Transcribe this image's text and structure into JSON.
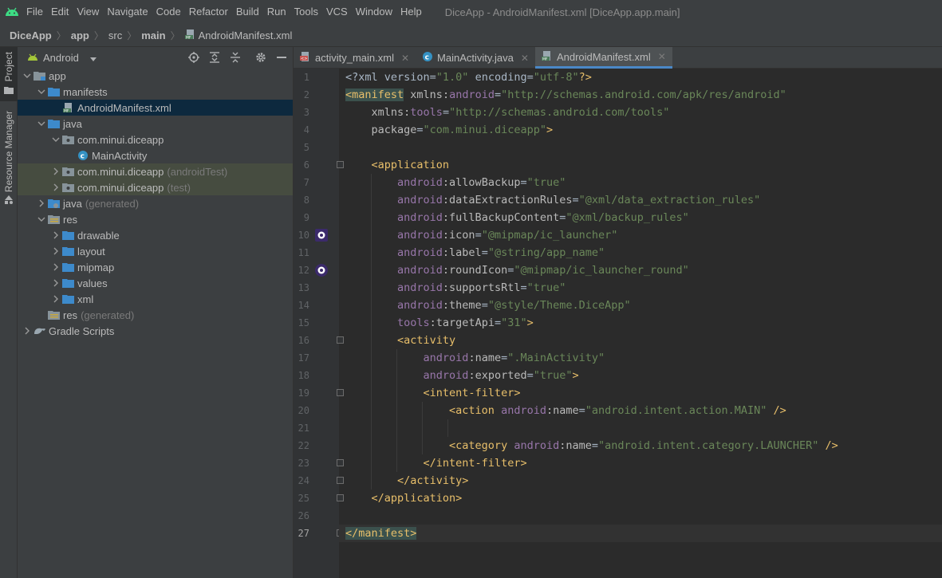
{
  "menubar": {
    "items": [
      "File",
      "Edit",
      "View",
      "Navigate",
      "Code",
      "Refactor",
      "Build",
      "Run",
      "Tools",
      "VCS",
      "Window",
      "Help"
    ],
    "title": "DiceApp - AndroidManifest.xml [DiceApp.app.main]"
  },
  "breadcrumb": [
    "DiceApp",
    "app",
    "src",
    "main",
    "AndroidManifest.xml"
  ],
  "toolstrip": {
    "project": "Project",
    "resource_manager": "Resource Manager"
  },
  "project_panel": {
    "view": "Android",
    "tree": [
      {
        "label": "app",
        "depth": 0,
        "arrow": "down",
        "icon": "module-folder-icon"
      },
      {
        "label": "manifests",
        "depth": 1,
        "arrow": "down",
        "icon": "folder-icon"
      },
      {
        "label": "AndroidManifest.xml",
        "depth": 2,
        "arrow": "",
        "icon": "manifest-file-icon",
        "selected": true
      },
      {
        "label": "java",
        "depth": 1,
        "arrow": "down",
        "icon": "folder-icon"
      },
      {
        "label": "com.minui.diceapp",
        "depth": 2,
        "arrow": "down",
        "icon": "package-icon"
      },
      {
        "label": "MainActivity",
        "depth": 3,
        "arrow": "",
        "icon": "class-icon"
      },
      {
        "label": "com.minui.diceapp",
        "suffix": "(androidTest)",
        "depth": 2,
        "arrow": "right",
        "icon": "package-icon",
        "tested": true
      },
      {
        "label": "com.minui.diceapp",
        "suffix": "(test)",
        "depth": 2,
        "arrow": "right",
        "icon": "package-icon",
        "tested": true
      },
      {
        "label": "java",
        "suffix": "(generated)",
        "depth": 1,
        "arrow": "right",
        "icon": "generated-folder-icon"
      },
      {
        "label": "res",
        "depth": 1,
        "arrow": "down",
        "icon": "res-folder-icon"
      },
      {
        "label": "drawable",
        "depth": 2,
        "arrow": "right",
        "icon": "folder-icon"
      },
      {
        "label": "layout",
        "depth": 2,
        "arrow": "right",
        "icon": "folder-icon"
      },
      {
        "label": "mipmap",
        "depth": 2,
        "arrow": "right",
        "icon": "folder-icon"
      },
      {
        "label": "values",
        "depth": 2,
        "arrow": "right",
        "icon": "folder-icon"
      },
      {
        "label": "xml",
        "depth": 2,
        "arrow": "right",
        "icon": "folder-icon"
      },
      {
        "label": "res",
        "suffix": "(generated)",
        "depth": 1,
        "arrow": "",
        "icon": "res-folder-icon"
      },
      {
        "label": "Gradle Scripts",
        "depth": 0,
        "arrow": "right",
        "icon": "gradle-icon"
      }
    ]
  },
  "tabs": [
    {
      "label": "activity_main.xml",
      "icon": "layout-xml-icon",
      "active": false
    },
    {
      "label": "MainActivity.java",
      "icon": "class-icon",
      "active": false
    },
    {
      "label": "AndroidManifest.xml",
      "icon": "manifest-file-icon",
      "active": true
    }
  ],
  "editor": {
    "current_line": 27,
    "lines": [
      [
        [
          "<?xml version=",
          "plain"
        ],
        [
          "\"1.0\"",
          "str"
        ],
        [
          " encoding=",
          "plain"
        ],
        [
          "\"utf-8\"",
          "str"
        ],
        [
          "?>",
          "tag"
        ]
      ],
      [
        [
          "<manifest",
          "hl"
        ],
        [
          " ",
          "plain"
        ],
        [
          "xmlns",
          "attr"
        ],
        [
          ":",
          "attr"
        ],
        [
          "android",
          "ns"
        ],
        [
          "=",
          "plain"
        ],
        [
          "\"http://schemas.android.com/apk/res/android\"",
          "str"
        ]
      ],
      [
        [
          "    xmlns",
          "attr"
        ],
        [
          ":",
          "attr"
        ],
        [
          "tools",
          "ns"
        ],
        [
          "=",
          "plain"
        ],
        [
          "\"http://schemas.android.com/tools\"",
          "str"
        ]
      ],
      [
        [
          "    package",
          "attr"
        ],
        [
          "=",
          "plain"
        ],
        [
          "\"com.minui.diceapp\"",
          "str"
        ],
        [
          ">",
          "tag"
        ]
      ],
      [],
      [
        [
          "    <application",
          "tag"
        ]
      ],
      [
        [
          "        android",
          "ns"
        ],
        [
          ":allowBackup",
          "attr"
        ],
        [
          "=",
          "plain"
        ],
        [
          "\"true\"",
          "str"
        ]
      ],
      [
        [
          "        android",
          "ns"
        ],
        [
          ":dataExtractionRules",
          "attr"
        ],
        [
          "=",
          "plain"
        ],
        [
          "\"@xml/data_extraction_rules\"",
          "str"
        ]
      ],
      [
        [
          "        android",
          "ns"
        ],
        [
          ":fullBackupContent",
          "attr"
        ],
        [
          "=",
          "plain"
        ],
        [
          "\"@xml/backup_rules\"",
          "str"
        ]
      ],
      [
        [
          "        android",
          "ns"
        ],
        [
          ":icon",
          "attr"
        ],
        [
          "=",
          "plain"
        ],
        [
          "\"@mipmap/ic_launcher\"",
          "str"
        ]
      ],
      [
        [
          "        android",
          "ns"
        ],
        [
          ":label",
          "attr"
        ],
        [
          "=",
          "plain"
        ],
        [
          "\"@string/app_name\"",
          "str"
        ]
      ],
      [
        [
          "        android",
          "ns"
        ],
        [
          ":roundIcon",
          "attr"
        ],
        [
          "=",
          "plain"
        ],
        [
          "\"@mipmap/ic_launcher_round\"",
          "str"
        ]
      ],
      [
        [
          "        android",
          "ns"
        ],
        [
          ":supportsRtl",
          "attr"
        ],
        [
          "=",
          "plain"
        ],
        [
          "\"true\"",
          "str"
        ]
      ],
      [
        [
          "        android",
          "ns"
        ],
        [
          ":theme",
          "attr"
        ],
        [
          "=",
          "plain"
        ],
        [
          "\"@style/Theme.DiceApp\"",
          "str"
        ]
      ],
      [
        [
          "        tools",
          "ns"
        ],
        [
          ":targetApi",
          "attr"
        ],
        [
          "=",
          "plain"
        ],
        [
          "\"31\"",
          "str"
        ],
        [
          ">",
          "tag"
        ]
      ],
      [
        [
          "        <activity",
          "tag"
        ]
      ],
      [
        [
          "            android",
          "ns"
        ],
        [
          ":name",
          "attr"
        ],
        [
          "=",
          "plain"
        ],
        [
          "\".MainActivity\"",
          "str"
        ]
      ],
      [
        [
          "            android",
          "ns"
        ],
        [
          ":exported",
          "attr"
        ],
        [
          "=",
          "plain"
        ],
        [
          "\"true\"",
          "str"
        ],
        [
          ">",
          "tag"
        ]
      ],
      [
        [
          "            <intent-filter>",
          "tag"
        ]
      ],
      [
        [
          "                <action ",
          "tag"
        ],
        [
          "android",
          "ns"
        ],
        [
          ":name",
          "attr"
        ],
        [
          "=",
          "plain"
        ],
        [
          "\"android.intent.action.MAIN\"",
          "str"
        ],
        [
          " />",
          "tag"
        ]
      ],
      [],
      [
        [
          "                <category ",
          "tag"
        ],
        [
          "android",
          "ns"
        ],
        [
          ":name",
          "attr"
        ],
        [
          "=",
          "plain"
        ],
        [
          "\"android.intent.category.LAUNCHER\"",
          "str"
        ],
        [
          " />",
          "tag"
        ]
      ],
      [
        [
          "            </intent-filter>",
          "tag"
        ]
      ],
      [
        [
          "        </activity>",
          "tag"
        ]
      ],
      [
        [
          "    </application>",
          "tag"
        ]
      ],
      [],
      [
        [
          "</manifest>",
          "hl"
        ]
      ]
    ]
  }
}
